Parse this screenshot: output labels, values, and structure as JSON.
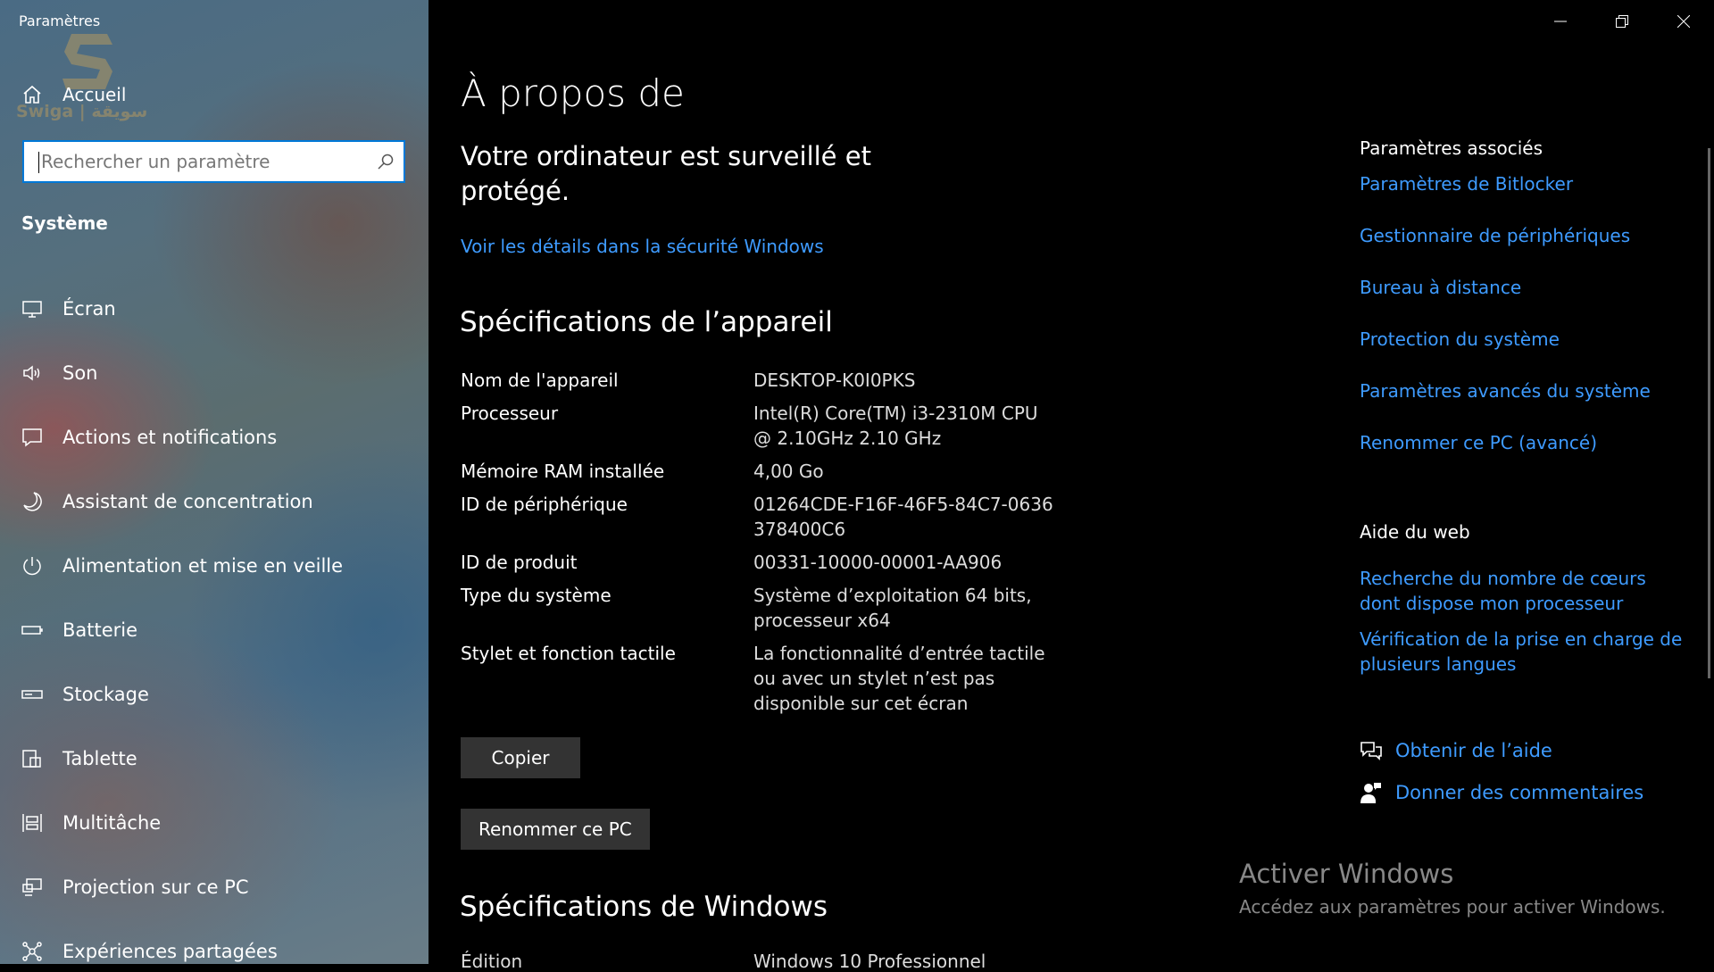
{
  "app": {
    "title": "Paramètres"
  },
  "watermark": {
    "text": "Swiga | سويقة"
  },
  "sidebar": {
    "home_label": "Accueil",
    "search_placeholder": "Rechercher un paramètre",
    "section": "Système",
    "items": [
      {
        "label": "Écran",
        "icon": "display-icon"
      },
      {
        "label": "Son",
        "icon": "speaker-icon"
      },
      {
        "label": "Actions et notifications",
        "icon": "message-icon"
      },
      {
        "label": "Assistant de concentration",
        "icon": "moon-icon"
      },
      {
        "label": "Alimentation et mise en veille",
        "icon": "power-icon"
      },
      {
        "label": "Batterie",
        "icon": "battery-icon"
      },
      {
        "label": "Stockage",
        "icon": "storage-icon"
      },
      {
        "label": "Tablette",
        "icon": "tablet-icon"
      },
      {
        "label": "Multitâche",
        "icon": "multitask-icon"
      },
      {
        "label": "Projection sur ce PC",
        "icon": "projection-icon"
      },
      {
        "label": "Expériences partagées",
        "icon": "share-icon"
      }
    ]
  },
  "main": {
    "title": "À propos de",
    "protection": "Votre ordinateur est surveillé et protégé.",
    "security_link": "Voir les détails dans la sécurité Windows",
    "device_specs_title": "Spécifications de l’appareil",
    "specs": [
      {
        "key": "Nom de l'appareil",
        "value": "DESKTOP-K0I0PKS"
      },
      {
        "key": "Processeur",
        "value": "Intel(R) Core(TM) i3-2310M CPU @ 2.10GHz   2.10 GHz"
      },
      {
        "key": "Mémoire RAM installée",
        "value": "4,00 Go"
      },
      {
        "key": "ID de périphérique",
        "value": "01264CDE-F16F-46F5-84C7-0636378400C6"
      },
      {
        "key": "ID de produit",
        "value": "00331-10000-00001-AA906"
      },
      {
        "key": "Type du système",
        "value": "Système d’exploitation 64 bits, processeur x64"
      },
      {
        "key": "Stylet et fonction tactile",
        "value": "La fonctionnalité d’entrée tactile ou avec un stylet n’est pas disponible sur cet écran"
      }
    ],
    "copy_button": "Copier",
    "rename_button": "Renommer ce PC",
    "windows_specs_title": "Spécifications de Windows",
    "partial_key": "Édition",
    "partial_value": "Windows 10 Professionnel"
  },
  "related": {
    "title": "Paramètres associés",
    "links": [
      "Paramètres de Bitlocker",
      "Gestionnaire de périphériques",
      "Bureau à distance",
      "Protection du système",
      "Paramètres avancés du système",
      "Renommer ce PC (avancé)"
    ],
    "web_help_title": "Aide du web",
    "web_links": [
      "Recherche du nombre de cœurs dont dispose mon processeur",
      "Vérification de la prise en charge de plusieurs langues"
    ],
    "get_help": "Obtenir de l’aide",
    "feedback": "Donner des commentaires"
  },
  "activation": {
    "title": "Activer Windows",
    "subtitle": "Accédez aux paramètres pour activer Windows."
  },
  "colors": {
    "accent": "#0078d7",
    "link": "#3e9bff",
    "background": "#000000"
  }
}
